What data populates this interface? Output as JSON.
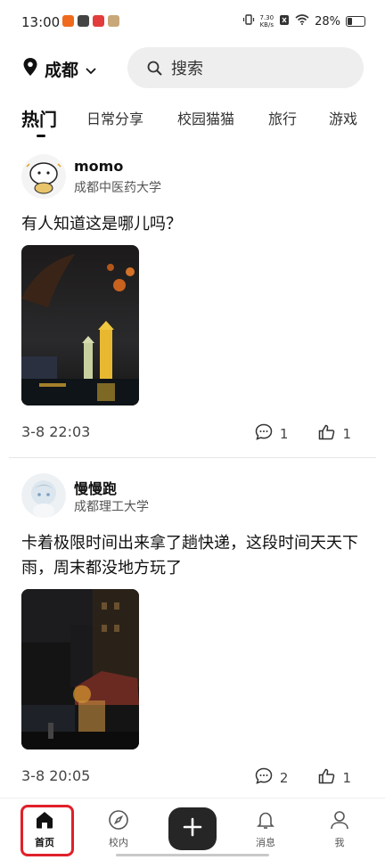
{
  "status_bar": {
    "time": "13:00",
    "net_speed": "7.30",
    "net_unit": "KB/s",
    "battery": "28%"
  },
  "header": {
    "location": "成都",
    "search_placeholder": "搜索"
  },
  "tabs": [
    {
      "label": "热门"
    },
    {
      "label": "日常分享"
    },
    {
      "label": "校园猫猫"
    },
    {
      "label": "旅行"
    },
    {
      "label": "游戏"
    }
  ],
  "posts": [
    {
      "username": "momo",
      "school": "成都中医药大学",
      "content": "有人知道这是哪儿吗？",
      "time": "3-8 22:03",
      "comments": "1",
      "likes": "1"
    },
    {
      "username": "慢慢跑",
      "school": "成都理工大学",
      "content": "卡着极限时间出来拿了趟快递，这段时间天天下雨，周末都没地方玩了",
      "time": "3-8 20:05",
      "comments": "2",
      "likes": "1"
    }
  ],
  "bottom_nav": [
    {
      "label": "首页",
      "icon": "home-icon"
    },
    {
      "label": "校内",
      "icon": "compass-icon"
    },
    {
      "label": "",
      "icon": "plus-icon"
    },
    {
      "label": "消息",
      "icon": "bell-icon"
    },
    {
      "label": "我",
      "icon": "person-icon"
    }
  ],
  "colors": {
    "highlight": "#e0202a",
    "plus_button": "#262626",
    "search_bg": "#eeeeee"
  }
}
